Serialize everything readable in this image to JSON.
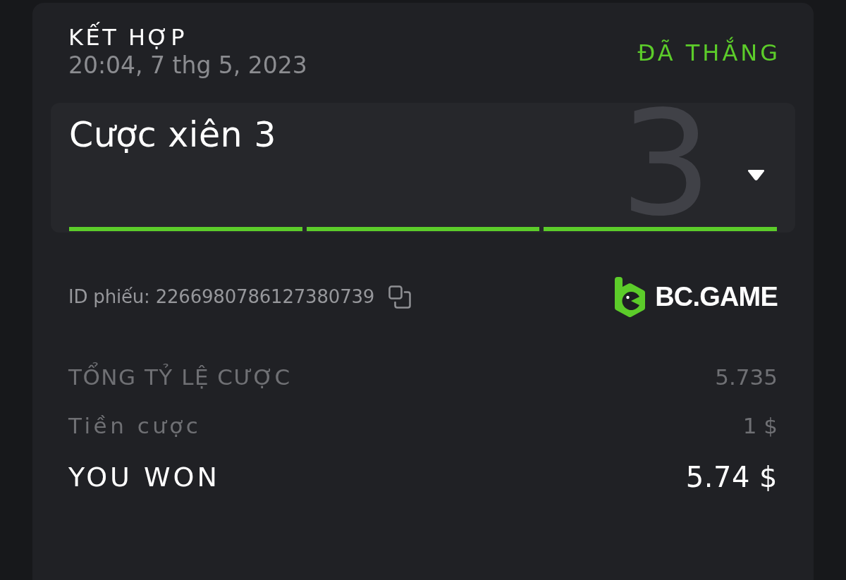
{
  "bet": {
    "type_label": "KẾT HỢP",
    "placed_at": "20:04, 7 thg 5, 2023",
    "status": {
      "label": "ĐÃ THẮNG",
      "kind": "won"
    },
    "parlay": {
      "title": "Cược xiên 3",
      "leg_count": "3",
      "expanded": false,
      "legs": [
        {
          "won": true
        },
        {
          "won": true
        },
        {
          "won": true
        }
      ]
    },
    "ticket_id": "ID phiếu: 2266980786127380739",
    "brand": {
      "name": "BC.GAME"
    },
    "summary": [
      {
        "label": "TỔNG TỶ LỆ CƯỢC",
        "value": "5.735",
        "kind": "muted"
      },
      {
        "label": "Tiền cược",
        "value": "1 $",
        "kind": "muted"
      },
      {
        "label": "YOU WON",
        "value": "5.74 $",
        "kind": "highlight"
      }
    ]
  }
}
